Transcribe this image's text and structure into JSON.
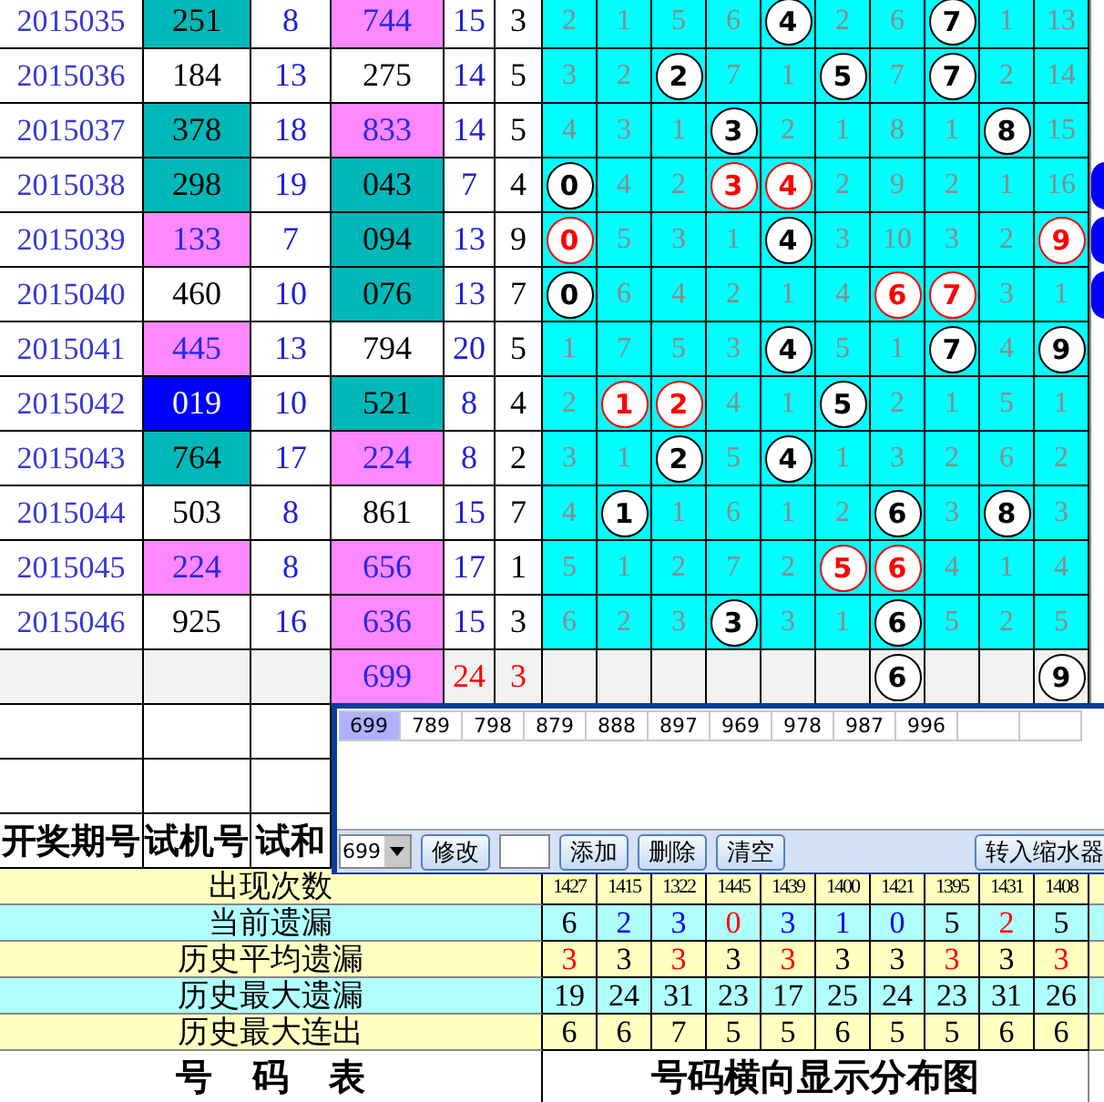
{
  "headers": {
    "period": "开奖期号",
    "trial": "试机号",
    "trial_sum": "试和"
  },
  "rows": [
    {
      "kind": "draw",
      "period": "2015035",
      "trial": {
        "text": "251",
        "color": "#00b8b8"
      },
      "trial_sum": "8",
      "column_4": {
        "text": "744",
        "color": "#ff88ff"
      },
      "column_5": "15",
      "column_6": "3",
      "edge_ball": false,
      "grid": [
        {
          "text": "2",
          "kind": "miss"
        },
        {
          "text": "1",
          "kind": "miss"
        },
        {
          "text": "5",
          "kind": "miss"
        },
        {
          "text": "6",
          "kind": "miss"
        },
        {
          "text": "4",
          "kind": "hit"
        },
        {
          "text": "2",
          "kind": "miss"
        },
        {
          "text": "6",
          "kind": "miss"
        },
        {
          "text": "7",
          "kind": "hit"
        },
        {
          "text": "1",
          "kind": "miss"
        },
        {
          "text": "13",
          "kind": "miss"
        }
      ]
    },
    {
      "kind": "draw",
      "period": "2015036",
      "trial": {
        "text": "184",
        "color": "#ffffff"
      },
      "trial_sum": "13",
      "column_4": {
        "text": "275",
        "color": "#ffffff"
      },
      "column_5": "14",
      "column_6": "5",
      "edge_ball": false,
      "grid": [
        {
          "text": "3",
          "kind": "miss"
        },
        {
          "text": "2",
          "kind": "miss"
        },
        {
          "text": "2",
          "kind": "hit"
        },
        {
          "text": "7",
          "kind": "miss"
        },
        {
          "text": "1",
          "kind": "miss"
        },
        {
          "text": "5",
          "kind": "hit"
        },
        {
          "text": "7",
          "kind": "miss"
        },
        {
          "text": "7",
          "kind": "hit"
        },
        {
          "text": "2",
          "kind": "miss"
        },
        {
          "text": "14",
          "kind": "miss"
        }
      ]
    },
    {
      "kind": "draw",
      "period": "2015037",
      "trial": {
        "text": "378",
        "color": "#00b8b8"
      },
      "trial_sum": "18",
      "column_4": {
        "text": "833",
        "color": "#ff88ff"
      },
      "column_5": "14",
      "column_6": "5",
      "edge_ball": false,
      "grid": [
        {
          "text": "4",
          "kind": "miss"
        },
        {
          "text": "3",
          "kind": "miss"
        },
        {
          "text": "1",
          "kind": "miss"
        },
        {
          "text": "3",
          "kind": "hit"
        },
        {
          "text": "2",
          "kind": "miss"
        },
        {
          "text": "1",
          "kind": "miss"
        },
        {
          "text": "8",
          "kind": "miss"
        },
        {
          "text": "1",
          "kind": "miss"
        },
        {
          "text": "8",
          "kind": "hit"
        },
        {
          "text": "15",
          "kind": "miss"
        }
      ]
    },
    {
      "kind": "draw",
      "period": "2015038",
      "trial": {
        "text": "298",
        "color": "#00b8b8"
      },
      "trial_sum": "19",
      "column_4": {
        "text": "043",
        "color": "#00b8b8"
      },
      "column_5": "7",
      "column_6": "4",
      "edge_ball": true,
      "grid": [
        {
          "text": "0",
          "kind": "hit"
        },
        {
          "text": "4",
          "kind": "miss"
        },
        {
          "text": "2",
          "kind": "miss"
        },
        {
          "text": "3",
          "kind": "trial_hit"
        },
        {
          "text": "4",
          "kind": "trial_hit"
        },
        {
          "text": "2",
          "kind": "miss"
        },
        {
          "text": "9",
          "kind": "miss"
        },
        {
          "text": "2",
          "kind": "miss"
        },
        {
          "text": "1",
          "kind": "miss"
        },
        {
          "text": "16",
          "kind": "miss"
        }
      ]
    },
    {
      "kind": "draw",
      "period": "2015039",
      "trial": {
        "text": "133",
        "color": "#ff88ff"
      },
      "trial_sum": "7",
      "column_4": {
        "text": "094",
        "color": "#00b8b8"
      },
      "column_5": "13",
      "column_6": "9",
      "edge_ball": true,
      "grid": [
        {
          "text": "0",
          "kind": "trial_hit"
        },
        {
          "text": "5",
          "kind": "miss"
        },
        {
          "text": "3",
          "kind": "miss"
        },
        {
          "text": "1",
          "kind": "miss"
        },
        {
          "text": "4",
          "kind": "hit"
        },
        {
          "text": "3",
          "kind": "miss"
        },
        {
          "text": "10",
          "kind": "miss"
        },
        {
          "text": "3",
          "kind": "miss"
        },
        {
          "text": "2",
          "kind": "miss"
        },
        {
          "text": "9",
          "kind": "trial_hit"
        }
      ]
    },
    {
      "kind": "draw",
      "period": "2015040",
      "trial": {
        "text": "460",
        "color": "#ffffff"
      },
      "trial_sum": "10",
      "column_4": {
        "text": "076",
        "color": "#00b8b8"
      },
      "column_5": "13",
      "column_6": "7",
      "edge_ball": true,
      "grid": [
        {
          "text": "0",
          "kind": "hit"
        },
        {
          "text": "6",
          "kind": "miss"
        },
        {
          "text": "4",
          "kind": "miss"
        },
        {
          "text": "2",
          "kind": "miss"
        },
        {
          "text": "1",
          "kind": "miss"
        },
        {
          "text": "4",
          "kind": "miss"
        },
        {
          "text": "6",
          "kind": "trial_hit"
        },
        {
          "text": "7",
          "kind": "trial_hit"
        },
        {
          "text": "3",
          "kind": "miss"
        },
        {
          "text": "1",
          "kind": "miss"
        }
      ]
    },
    {
      "kind": "draw",
      "period": "2015041",
      "trial": {
        "text": "445",
        "color": "#ff88ff"
      },
      "trial_sum": "13",
      "column_4": {
        "text": "794",
        "color": "#ffffff"
      },
      "column_5": "20",
      "column_6": "5",
      "edge_ball": false,
      "grid": [
        {
          "text": "1",
          "kind": "miss"
        },
        {
          "text": "7",
          "kind": "miss"
        },
        {
          "text": "5",
          "kind": "miss"
        },
        {
          "text": "3",
          "kind": "miss"
        },
        {
          "text": "4",
          "kind": "hit"
        },
        {
          "text": "5",
          "kind": "miss"
        },
        {
          "text": "1",
          "kind": "miss"
        },
        {
          "text": "7",
          "kind": "hit"
        },
        {
          "text": "4",
          "kind": "miss"
        },
        {
          "text": "9",
          "kind": "hit"
        }
      ]
    },
    {
      "kind": "draw",
      "period": "2015042",
      "trial": {
        "text": "019",
        "color": "#0000ff"
      },
      "trial_sum": "10",
      "column_4": {
        "text": "521",
        "color": "#00b8b8"
      },
      "column_5": "8",
      "column_6": "4",
      "edge_ball": false,
      "grid": [
        {
          "text": "2",
          "kind": "miss"
        },
        {
          "text": "1",
          "kind": "trial_hit"
        },
        {
          "text": "2",
          "kind": "trial_hit"
        },
        {
          "text": "4",
          "kind": "miss"
        },
        {
          "text": "1",
          "kind": "miss"
        },
        {
          "text": "5",
          "kind": "hit"
        },
        {
          "text": "2",
          "kind": "miss"
        },
        {
          "text": "1",
          "kind": "miss"
        },
        {
          "text": "5",
          "kind": "miss"
        },
        {
          "text": "1",
          "kind": "miss"
        }
      ]
    },
    {
      "kind": "draw",
      "period": "2015043",
      "trial": {
        "text": "764",
        "color": "#00b8b8"
      },
      "trial_sum": "17",
      "column_4": {
        "text": "224",
        "color": "#ff88ff"
      },
      "column_5": "8",
      "column_6": "2",
      "edge_ball": false,
      "grid": [
        {
          "text": "3",
          "kind": "miss"
        },
        {
          "text": "1",
          "kind": "miss"
        },
        {
          "text": "2",
          "kind": "hit"
        },
        {
          "text": "5",
          "kind": "miss"
        },
        {
          "text": "4",
          "kind": "hit"
        },
        {
          "text": "1",
          "kind": "miss"
        },
        {
          "text": "3",
          "kind": "miss"
        },
        {
          "text": "2",
          "kind": "miss"
        },
        {
          "text": "6",
          "kind": "miss"
        },
        {
          "text": "2",
          "kind": "miss"
        }
      ]
    },
    {
      "kind": "draw",
      "period": "2015044",
      "trial": {
        "text": "503",
        "color": "#ffffff"
      },
      "trial_sum": "8",
      "column_4": {
        "text": "861",
        "color": "#ffffff"
      },
      "column_5": "15",
      "column_6": "7",
      "edge_ball": false,
      "grid": [
        {
          "text": "4",
          "kind": "miss"
        },
        {
          "text": "1",
          "kind": "hit"
        },
        {
          "text": "1",
          "kind": "miss"
        },
        {
          "text": "6",
          "kind": "miss"
        },
        {
          "text": "1",
          "kind": "miss"
        },
        {
          "text": "2",
          "kind": "miss"
        },
        {
          "text": "6",
          "kind": "hit"
        },
        {
          "text": "3",
          "kind": "miss"
        },
        {
          "text": "8",
          "kind": "hit"
        },
        {
          "text": "3",
          "kind": "miss"
        }
      ]
    },
    {
      "kind": "draw",
      "period": "2015045",
      "trial": {
        "text": "224",
        "color": "#ff88ff"
      },
      "trial_sum": "8",
      "column_4": {
        "text": "656",
        "color": "#ff88ff"
      },
      "column_5": "17",
      "column_6": "1",
      "edge_ball": false,
      "grid": [
        {
          "text": "5",
          "kind": "miss"
        },
        {
          "text": "1",
          "kind": "miss"
        },
        {
          "text": "2",
          "kind": "miss"
        },
        {
          "text": "7",
          "kind": "miss"
        },
        {
          "text": "2",
          "kind": "miss"
        },
        {
          "text": "5",
          "kind": "trial_hit"
        },
        {
          "text": "6",
          "kind": "trial_hit"
        },
        {
          "text": "4",
          "kind": "miss"
        },
        {
          "text": "1",
          "kind": "miss"
        },
        {
          "text": "4",
          "kind": "miss"
        }
      ]
    },
    {
      "kind": "draw",
      "period": "2015046",
      "trial": {
        "text": "925",
        "color": "#ffffff"
      },
      "trial_sum": "16",
      "column_4": {
        "text": "636",
        "color": "#ff88ff"
      },
      "column_5": "15",
      "column_6": "3",
      "edge_ball": false,
      "grid": [
        {
          "text": "6",
          "kind": "miss"
        },
        {
          "text": "2",
          "kind": "miss"
        },
        {
          "text": "3",
          "kind": "miss"
        },
        {
          "text": "3",
          "kind": "hit"
        },
        {
          "text": "3",
          "kind": "miss"
        },
        {
          "text": "1",
          "kind": "miss"
        },
        {
          "text": "6",
          "kind": "hit"
        },
        {
          "text": "5",
          "kind": "miss"
        },
        {
          "text": "2",
          "kind": "miss"
        },
        {
          "text": "5",
          "kind": "miss"
        }
      ]
    },
    {
      "kind": "pending",
      "column_4": {
        "text": "699",
        "color": "#ff88ff"
      },
      "column_5": "24",
      "column_6": "3",
      "grid": [
        {
          "kind": "blank"
        },
        {
          "kind": "blank"
        },
        {
          "kind": "blank"
        },
        {
          "kind": "blank"
        },
        {
          "kind": "blank"
        },
        {
          "kind": "blank"
        },
        {
          "text": "6",
          "kind": "hit"
        },
        {
          "kind": "blank"
        },
        {
          "kind": "blank"
        },
        {
          "text": "9",
          "kind": "hit"
        }
      ]
    }
  ],
  "stats": [
    {
      "label": "出现次数",
      "kind": "count",
      "values": [
        "1427",
        "1415",
        "1322",
        "1445",
        "1439",
        "1400",
        "1421",
        "1395",
        "1431",
        "1408"
      ]
    },
    {
      "label": "当前遗漏",
      "kind": "colored",
      "values": [
        {
          "text": "6",
          "color": "#000000"
        },
        {
          "text": "2",
          "color": "#0000ff"
        },
        {
          "text": "3",
          "color": "#0000ff"
        },
        {
          "text": "0",
          "color": "#ff0000"
        },
        {
          "text": "3",
          "color": "#0000ff"
        },
        {
          "text": "1",
          "color": "#0000ff"
        },
        {
          "text": "0",
          "color": "#0000ff"
        },
        {
          "text": "5",
          "color": "#000000"
        },
        {
          "text": "2",
          "color": "#ff0000"
        },
        {
          "text": "5",
          "color": "#000000"
        }
      ]
    },
    {
      "label": "历史平均遗漏",
      "kind": "colored",
      "values": [
        {
          "text": "3",
          "color": "#ff0000"
        },
        {
          "text": "3",
          "color": "#000000"
        },
        {
          "text": "3",
          "color": "#ff0000"
        },
        {
          "text": "3",
          "color": "#000000"
        },
        {
          "text": "3",
          "color": "#ff0000"
        },
        {
          "text": "3",
          "color": "#000000"
        },
        {
          "text": "3",
          "color": "#000000"
        },
        {
          "text": "3",
          "color": "#ff0000"
        },
        {
          "text": "3",
          "color": "#000000"
        },
        {
          "text": "3",
          "color": "#ff0000"
        }
      ]
    },
    {
      "label": "历史最大遗漏",
      "kind": "plain",
      "values": [
        "19",
        "24",
        "31",
        "23",
        "17",
        "25",
        "24",
        "23",
        "31",
        "26"
      ]
    },
    {
      "label": "历史最大连出",
      "kind": "plain",
      "values": [
        "6",
        "6",
        "7",
        "5",
        "5",
        "6",
        "5",
        "5",
        "6",
        "6"
      ]
    }
  ],
  "footer": {
    "left": "号码表",
    "right": "号码横向显示分布图"
  },
  "popup": {
    "candidates": [
      {
        "text": "699",
        "selected": true
      },
      {
        "text": "789",
        "selected": false
      },
      {
        "text": "798",
        "selected": false
      },
      {
        "text": "879",
        "selected": false
      },
      {
        "text": "888",
        "selected": false
      },
      {
        "text": "897",
        "selected": false
      },
      {
        "text": "969",
        "selected": false
      },
      {
        "text": "978",
        "selected": false
      },
      {
        "text": "987",
        "selected": false
      },
      {
        "text": "996",
        "selected": false
      }
    ],
    "toolbar": [
      {
        "kind": "dropdown",
        "value": "699"
      },
      {
        "kind": "button",
        "label": "修改"
      },
      {
        "kind": "field"
      },
      {
        "kind": "button",
        "label": "添加"
      },
      {
        "kind": "button",
        "label": "删除"
      },
      {
        "kind": "button",
        "label": "清空"
      },
      {
        "kind": "end_button",
        "label": "转入缩水器"
      }
    ]
  }
}
